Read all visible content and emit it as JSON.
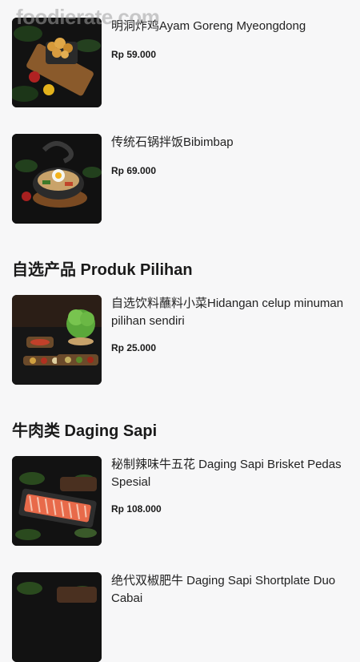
{
  "watermark": "foodierate.com",
  "items": [
    {
      "name": "明洞炸鸡Ayam Goreng Myeongdong",
      "price": "Rp 59.000",
      "image": "fried-chicken-photo"
    },
    {
      "name": "传统石锅拌饭Bibimbap",
      "price": "Rp 69.000",
      "image": "bibimbap-photo"
    },
    {
      "name": "自选饮料蘸料小菜Hidangan celup minuman pilihan sendiri",
      "price": "Rp 25.000",
      "image": "side-dishes-photo"
    },
    {
      "name": "秘制辣味牛五花 Daging Sapi Brisket Pedas Spesial",
      "price": "Rp 108.000",
      "image": "beef-brisket-photo"
    },
    {
      "name": "绝代双椒肥牛 Daging Sapi Shortplate Duo Cabai",
      "price": "",
      "image": "beef-shortplate-photo"
    }
  ],
  "sections": {
    "produk_pilihan": "自选产品 Produk Pilihan",
    "daging_sapi": "牛肉类 Daging Sapi"
  }
}
